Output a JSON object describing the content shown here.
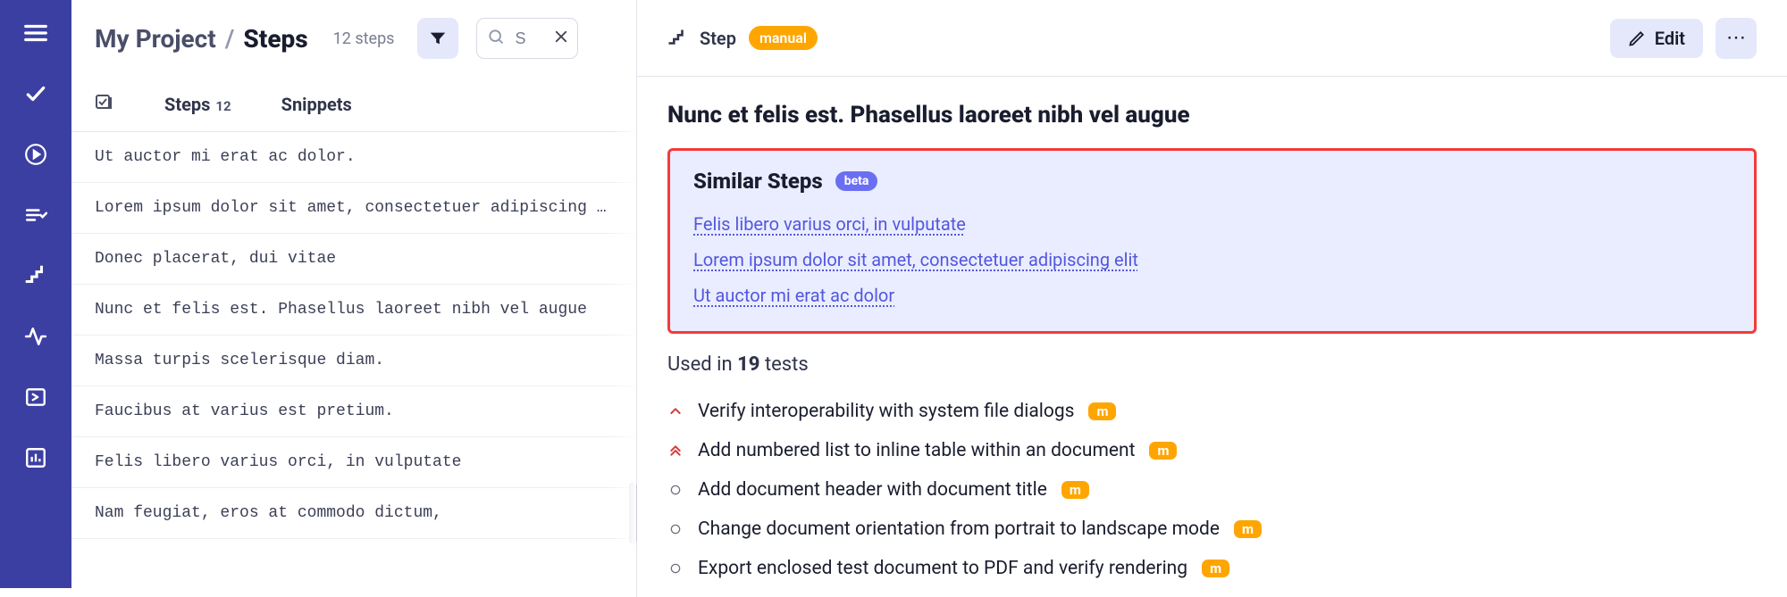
{
  "header": {
    "project": "My Project",
    "page": "Steps",
    "step_count_label": "12 steps",
    "search_value": "S",
    "search_placeholder": "Search"
  },
  "tabs": {
    "steps_label": "Steps",
    "steps_count": "12",
    "snippets_label": "Snippets"
  },
  "steps": [
    "Ut auctor mi erat ac dolor.",
    "Lorem ipsum dolor sit amet, consectetuer adipiscing elit",
    "Donec placerat, dui vitae",
    "Nunc et felis est. Phasellus laoreet nibh vel augue",
    "Massa turpis scelerisque diam.",
    "Faucibus at varius est pretium.",
    "Felis libero varius orci, in vulputate",
    "Nam feugiat, eros at commodo dictum,"
  ],
  "detail": {
    "crumb_label": "Step",
    "badge": "manual",
    "edit_label": "Edit",
    "title": "Nunc et felis est. Phasellus laoreet nibh vel augue",
    "similar_title": "Similar Steps",
    "beta_label": "beta",
    "similar_links": [
      "Felis libero varius orci, in vulputate",
      "Lorem ipsum dolor sit amet, consectetuer adipiscing elit",
      "Ut auctor mi erat ac dolor"
    ],
    "used_in_prefix": "Used in ",
    "used_in_count": "19",
    "used_in_suffix": " tests",
    "tests": [
      {
        "priority": "high",
        "name": "Verify interoperability with system file dialogs",
        "badge": "m"
      },
      {
        "priority": "highest",
        "name": "Add numbered list to inline table within an document",
        "badge": "m"
      },
      {
        "priority": "low",
        "name": "Add document header with document title",
        "badge": "m"
      },
      {
        "priority": "low",
        "name": "Change document orientation from portrait to landscape mode",
        "badge": "m"
      },
      {
        "priority": "low",
        "name": "Export enclosed test document to PDF and verify rendering",
        "badge": "m"
      }
    ]
  }
}
